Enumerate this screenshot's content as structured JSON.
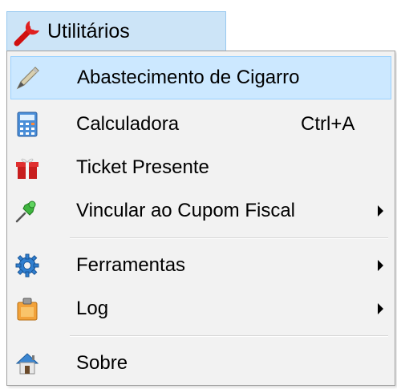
{
  "header": {
    "label": "Utilitários",
    "icon": "wrench-icon",
    "accent": "#cce4f7"
  },
  "menu": {
    "items": [
      {
        "label": "Abastecimento de Cigarro",
        "icon": "pencil-icon",
        "shortcut": "",
        "submenu": false,
        "highlighted": true
      },
      {
        "label": "Calculadora",
        "icon": "calculator-icon",
        "shortcut": "Ctrl+A",
        "submenu": false,
        "highlighted": false
      },
      {
        "label": "Ticket Presente",
        "icon": "gift-icon",
        "shortcut": "",
        "submenu": false,
        "highlighted": false
      },
      {
        "label": "Vincular ao Cupom Fiscal",
        "icon": "pushpin-icon",
        "shortcut": "",
        "submenu": true,
        "highlighted": false
      },
      {
        "label": "Ferramentas",
        "icon": "gear-icon",
        "shortcut": "",
        "submenu": true,
        "highlighted": false
      },
      {
        "label": "Log",
        "icon": "clipboard-icon",
        "shortcut": "",
        "submenu": true,
        "highlighted": false
      },
      {
        "label": "Sobre",
        "icon": "home-icon",
        "shortcut": "",
        "submenu": false,
        "highlighted": false
      }
    ]
  },
  "colors": {
    "highlight_bg": "#cce8ff",
    "highlight_border": "#99d1ff",
    "menu_bg": "#f2f2f2"
  }
}
